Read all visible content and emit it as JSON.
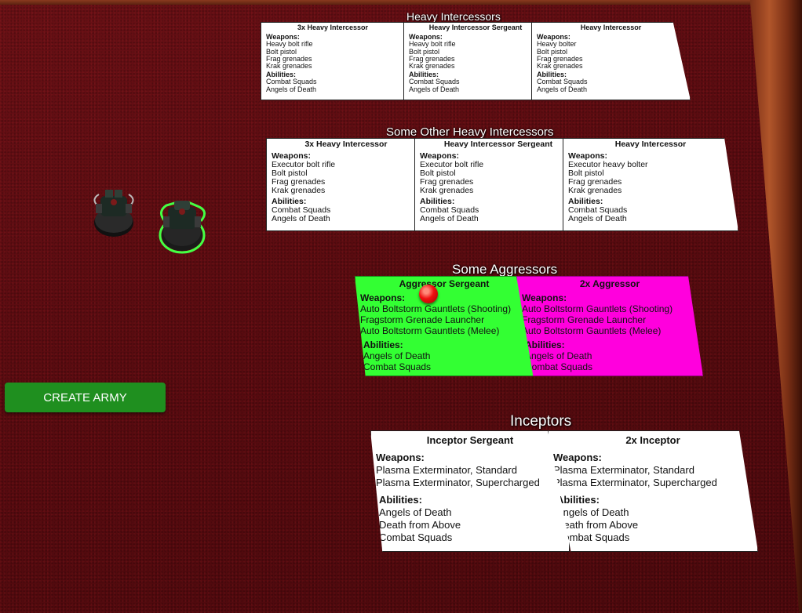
{
  "create_army_button": "CREATE ARMY",
  "groups": {
    "g1": {
      "title": "Heavy Intercessors",
      "cards": [
        {
          "name": "3x Heavy Intercessor",
          "weapons_label": "Weapons:",
          "weapons": [
            "Heavy bolt rifle",
            "Bolt pistol",
            "Frag grenades",
            "Krak grenades"
          ],
          "abilities_label": "Abilities:",
          "abilities": [
            "Combat Squads",
            "Angels of Death"
          ]
        },
        {
          "name": "Heavy Intercessor Sergeant",
          "weapons_label": "Weapons:",
          "weapons": [
            "Heavy bolt rifle",
            "Bolt pistol",
            "Frag grenades",
            "Krak grenades"
          ],
          "abilities_label": "Abilities:",
          "abilities": [
            "Combat Squads",
            "Angels of Death"
          ]
        },
        {
          "name": "Heavy Intercessor",
          "weapons_label": "Weapons:",
          "weapons": [
            "Heavy bolter",
            "Bolt pistol",
            "Frag grenades",
            "Krak grenades"
          ],
          "abilities_label": "Abilities:",
          "abilities": [
            "Combat Squads",
            "Angels of Death"
          ]
        }
      ]
    },
    "g2": {
      "title": "Some Other Heavy Intercessors",
      "cards": [
        {
          "name": "3x Heavy Intercessor",
          "weapons_label": "Weapons:",
          "weapons": [
            "Executor bolt rifle",
            "Bolt pistol",
            "Frag grenades",
            "Krak grenades"
          ],
          "abilities_label": "Abilities:",
          "abilities": [
            "Combat Squads",
            "Angels of Death"
          ]
        },
        {
          "name": "Heavy Intercessor Sergeant",
          "weapons_label": "Weapons:",
          "weapons": [
            "Executor bolt rifle",
            "Bolt pistol",
            "Frag grenades",
            "Krak grenades"
          ],
          "abilities_label": "Abilities:",
          "abilities": [
            "Combat Squads",
            "Angels of Death"
          ]
        },
        {
          "name": "Heavy Intercessor",
          "weapons_label": "Weapons:",
          "weapons": [
            "Executor heavy bolter",
            "Bolt pistol",
            "Frag grenades",
            "Krak grenades"
          ],
          "abilities_label": "Abilities:",
          "abilities": [
            "Combat Squads",
            "Angels of Death"
          ]
        }
      ]
    },
    "g3": {
      "title": "Some Aggressors",
      "cards": [
        {
          "name": "Aggressor Sergeant",
          "color": "#33ff33",
          "weapons_label": "Weapons:",
          "weapons": [
            "Auto Boltstorm Gauntlets (Shooting)",
            "Fragstorm Grenade Launcher",
            "Auto Boltstorm Gauntlets (Melee)"
          ],
          "abilities_label": "Abilities:",
          "abilities": [
            "Angels of Death",
            "Combat Squads"
          ]
        },
        {
          "name": "2x Aggressor",
          "color": "#ff00dd",
          "weapons_label": "Weapons:",
          "weapons": [
            "Auto Boltstorm Gauntlets (Shooting)",
            "Fragstorm Grenade Launcher",
            "Auto Boltstorm Gauntlets (Melee)"
          ],
          "abilities_label": "Abilities:",
          "abilities": [
            "Angels of Death",
            "Combat Squads"
          ]
        }
      ]
    },
    "g4": {
      "title": "Inceptors",
      "cards": [
        {
          "name": "Inceptor Sergeant",
          "weapons_label": "Weapons:",
          "weapons": [
            "Plasma Exterminator, Standard",
            "Plasma Exterminator, Supercharged"
          ],
          "abilities_label": "Abilities:",
          "abilities": [
            "Angels of Death",
            "Death from Above",
            "Combat Squads"
          ]
        },
        {
          "name": "2x Inceptor",
          "weapons_label": "Weapons:",
          "weapons": [
            "Plasma Exterminator, Standard",
            "Plasma Exterminator, Supercharged"
          ],
          "abilities_label": "Abilities:",
          "abilities": [
            "Angels of Death",
            "Death from Above",
            "Combat Squads"
          ]
        }
      ]
    }
  },
  "colors": {
    "table": "#5a0c10",
    "button": "#1f8f1f",
    "selection_outline": "#44ff44",
    "marker": "#ee1010"
  },
  "icons": {
    "miniature": "space-marine-miniature-icon",
    "marker": "red-pushpin-icon"
  }
}
